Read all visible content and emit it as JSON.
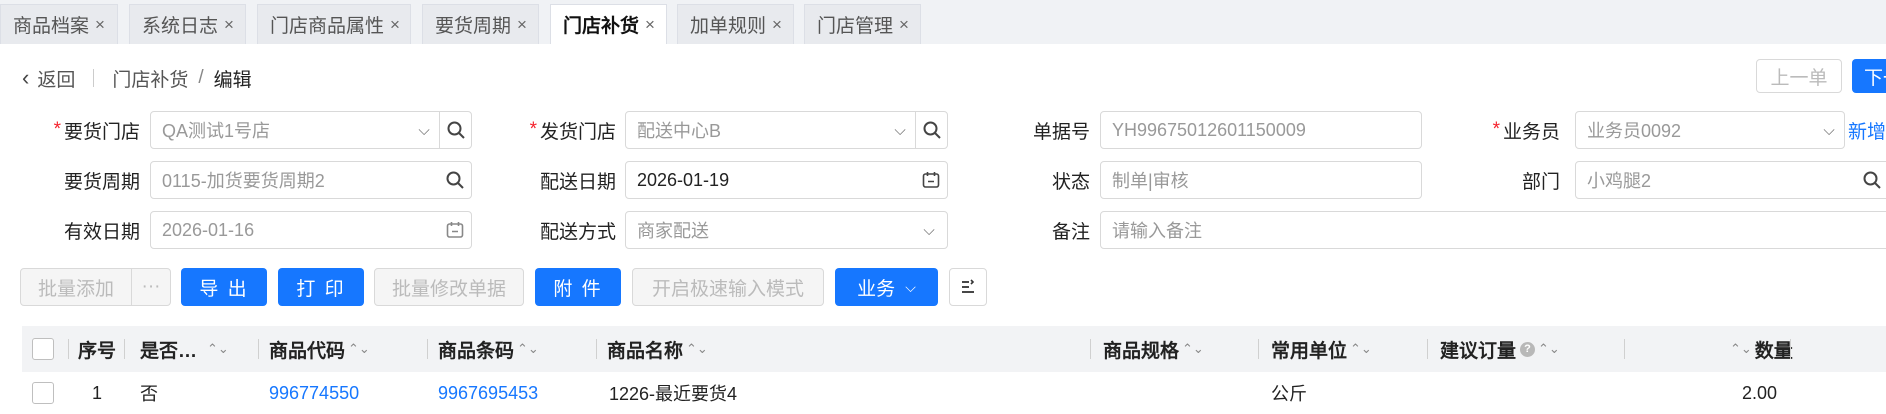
{
  "tabs": [
    {
      "label": "商品档案",
      "close": "×"
    },
    {
      "label": "系统日志",
      "close": "×"
    },
    {
      "label": "门店商品属性",
      "close": "×"
    },
    {
      "label": "要货周期",
      "close": "×"
    },
    {
      "label": "门店补货",
      "close": "×"
    },
    {
      "label": "加单规则",
      "close": "×"
    },
    {
      "label": "门店管理",
      "close": "×"
    }
  ],
  "active_tab": "门店补货",
  "breadcrumb": {
    "back": "返回",
    "parent": "门店补货",
    "separator": "/",
    "current": "编辑"
  },
  "nav": {
    "prev": "上一单",
    "next": "下一"
  },
  "form": {
    "require_store": {
      "label": "要货门店",
      "value": "QA测试1号店"
    },
    "ship_store": {
      "label": "发货门店",
      "value": "配送中心B"
    },
    "doc_no": {
      "label": "单据号",
      "value": "YH99675012601150009"
    },
    "salesman": {
      "label": "业务员",
      "value": "业务员0092",
      "add": "新增"
    },
    "cycle": {
      "label": "要货周期",
      "value": "0115-加货要货周期2"
    },
    "ship_date": {
      "label": "配送日期",
      "value": "2026-01-19"
    },
    "status": {
      "label": "状态",
      "value": "制单|审核"
    },
    "dept": {
      "label": "部门",
      "value": "小鸡腿2"
    },
    "valid_date": {
      "label": "有效日期",
      "value": "2026-01-16"
    },
    "ship_mode": {
      "label": "配送方式",
      "value": "商家配送"
    },
    "remark": {
      "label": "备注",
      "placeholder": "请输入备注"
    }
  },
  "toolbar": {
    "batch_add": "批量添加",
    "more": "···",
    "export": "导 出",
    "print": "打 印",
    "batch_edit": "批量修改单据",
    "attach": "附 件",
    "fast_mode": "开启极速输入模式",
    "business": "业务"
  },
  "table": {
    "headers": [
      "序号",
      "是否…",
      "商品代码",
      "商品条码",
      "商品名称",
      "商品规格",
      "常用单位",
      "建议订量",
      "数量"
    ],
    "rows": [
      {
        "seq": "1",
        "flag": "否",
        "code": "996774550",
        "barcode": "9967695453",
        "name": "1226-最近要货4",
        "spec": "",
        "unit": "公斤",
        "suggest": "",
        "qty": "2.00"
      }
    ]
  },
  "colors": {
    "primary": "#1677ff",
    "required": "#f5222d"
  }
}
